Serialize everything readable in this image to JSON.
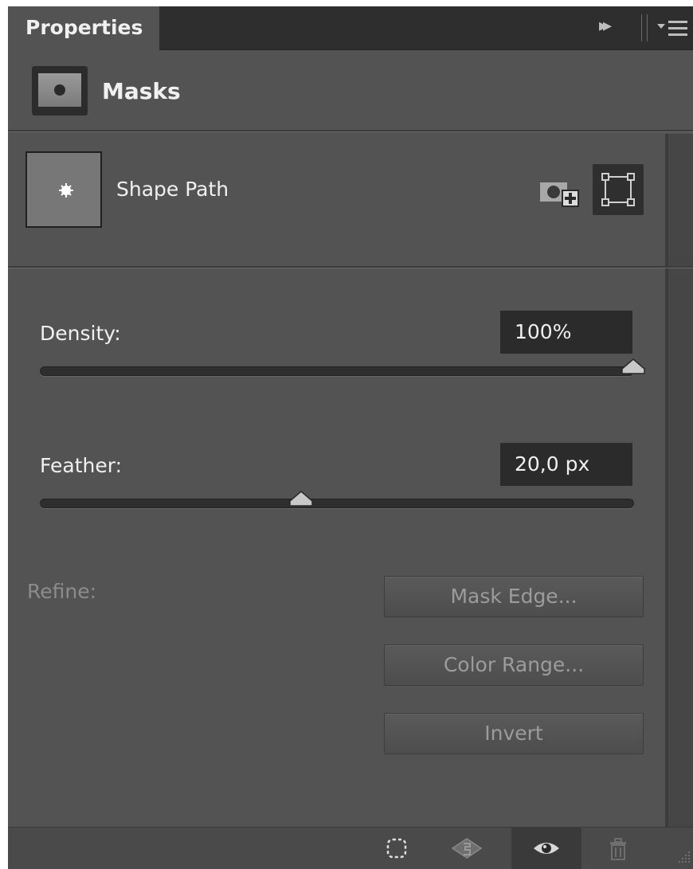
{
  "panel": {
    "tab_label": "Properties",
    "collapse_glyph": "▸▸",
    "menu_icon": "panel-menu-icon"
  },
  "masks": {
    "title": "Masks",
    "icon": "layer-mask-icon"
  },
  "shape": {
    "label": "Shape Path",
    "add_pixel_mask_icon": "add-pixel-mask-icon",
    "add_vector_mask_icon": "vector-mask-icon"
  },
  "density": {
    "label": "Density:",
    "value": "100%",
    "level_percent": 100
  },
  "feather": {
    "label": "Feather:",
    "value": "20,0 px",
    "level_fraction": 0.44
  },
  "refine": {
    "label": "Refine:",
    "buttons": [
      "Mask Edge...",
      "Color Range...",
      "Invert"
    ]
  },
  "bottom_bar": {
    "icons": [
      "load-selection-icon",
      "apply-mask-icon",
      "visibility-icon",
      "delete-icon"
    ]
  },
  "colors": {
    "panel_bg": "#535353",
    "dark_bg": "#2e2e2e",
    "text": "#f0f0f0",
    "disabled_text": "#8c8c8c"
  }
}
